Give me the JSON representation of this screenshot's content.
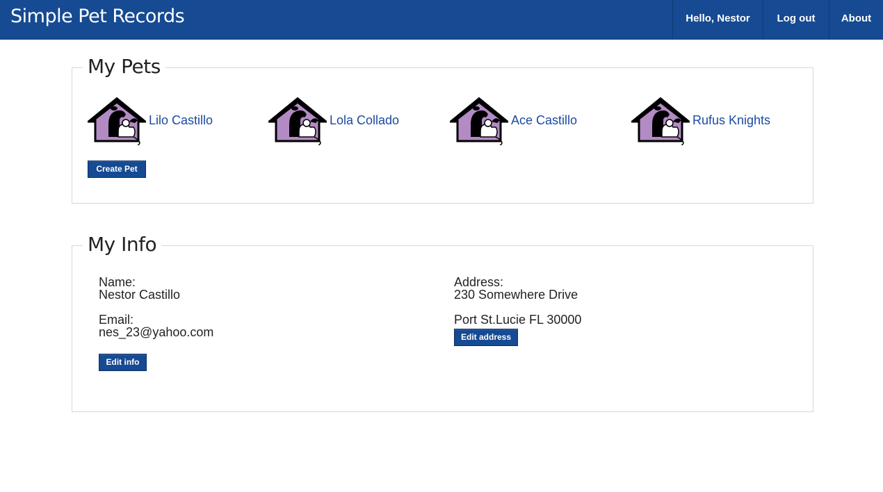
{
  "header": {
    "brand": "Simple Pet Records",
    "nav": {
      "greeting": "Hello, Nestor",
      "logout": "Log out",
      "about": "About"
    }
  },
  "pets_section": {
    "legend": "My Pets",
    "pets": [
      {
        "name": "Lilo Castillo",
        "icon": "pet-house-icon"
      },
      {
        "name": "Lola Collado",
        "icon": "pet-house-icon"
      },
      {
        "name": "Ace Castillo",
        "icon": "pet-house-icon"
      },
      {
        "name": "Rufus Knights",
        "icon": "pet-house-icon"
      }
    ],
    "create_button": "Create Pet"
  },
  "info_section": {
    "legend": "My Info",
    "name_label": "Name:",
    "name_value": "Nestor Castillo",
    "email_label": "Email:",
    "email_value": "nes_23@yahoo.com",
    "edit_info_button": "Edit info",
    "address_label": "Address:",
    "address_line1": "230 Somewhere Drive",
    "address_line2": "Port St.Lucie FL 30000",
    "edit_address_button": "Edit address"
  },
  "colors": {
    "primary": "#164a92",
    "link": "#1b4aa0",
    "icon_fill": "#b28bc4"
  }
}
